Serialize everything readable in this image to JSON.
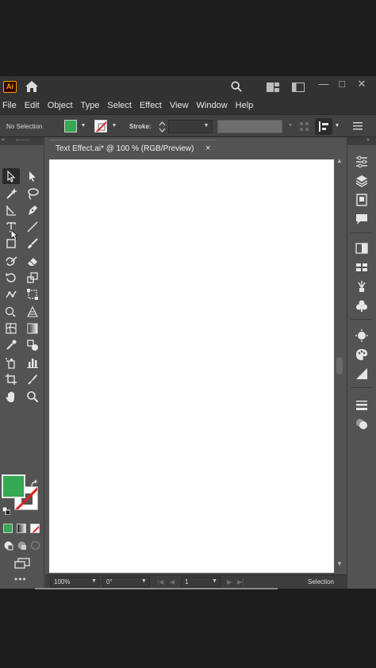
{
  "app": {
    "logo_text": "Ai",
    "accent": "#ff9a00",
    "title_buttons": {
      "minimize": "—",
      "maximize": "□",
      "close": "✕"
    }
  },
  "menu": [
    "File",
    "Edit",
    "Object",
    "Type",
    "Select",
    "Effect",
    "View",
    "Window",
    "Help"
  ],
  "control_bar": {
    "selection_text": "No Selection",
    "fill_color": "#34a853",
    "stroke_label": "Stroke:"
  },
  "document_tab": {
    "title": "Text Effect.ai* @ 100 % (RGB/Preview)",
    "close": "×"
  },
  "tools": [
    "selection-tool",
    "direct-selection-tool",
    "magic-wand-tool",
    "lasso-tool",
    "curvature-tool",
    "pen-tool",
    "type-tool",
    "line-segment-tool",
    "rectangle-tool",
    "paintbrush-tool",
    "shaper-tool",
    "eraser-tool",
    "rotate-tool",
    "scale-tool",
    "puppet-warp-tool",
    "free-transform-tool",
    "shape-builder-tool",
    "perspective-grid-tool",
    "mesh-tool",
    "gradient-tool",
    "eyedropper-tool",
    "blend-tool",
    "symbol-sprayer-tool",
    "column-graph-tool",
    "artboard-tool",
    "slice-tool",
    "hand-tool",
    "zoom-tool"
  ],
  "more_tools": "•••",
  "status_bar": {
    "zoom": "100%",
    "rotation": "0°",
    "artboard_number": "1",
    "tool_name": "Selection"
  }
}
